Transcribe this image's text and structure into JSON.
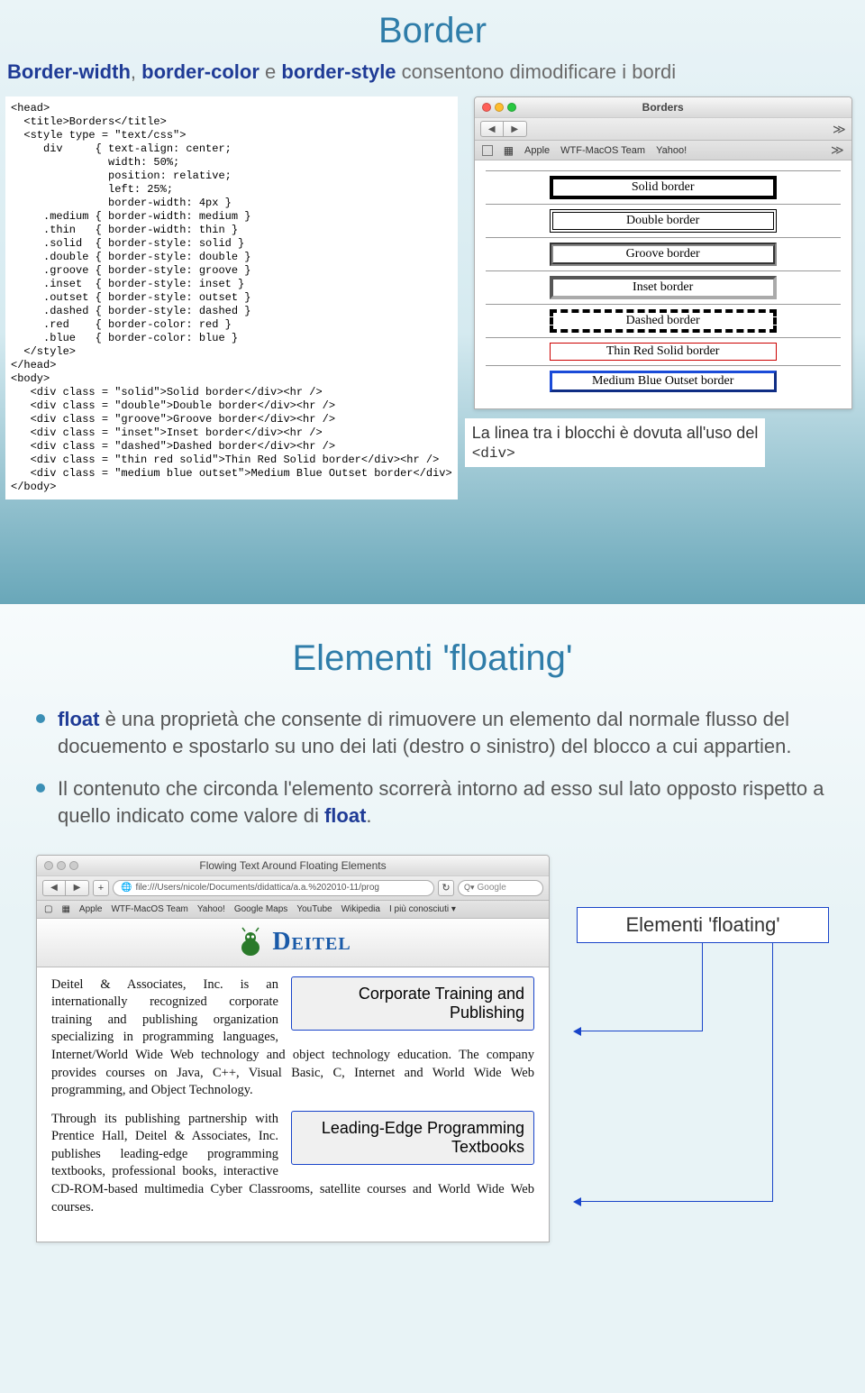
{
  "slide1": {
    "title": "Border",
    "subtitle": {
      "a": "Border-width",
      "sep1": ", ",
      "b": "border-color",
      "sep2": " e ",
      "c": "border-style",
      "rest": " consentono dimodificare i bordi"
    },
    "code": "<head>\n  <title>Borders</title>\n  <style type = \"text/css\">\n     div     { text-align: center;\n               width: 50%;\n               position: relative;\n               left: 25%;\n               border-width: 4px }\n     .medium { border-width: medium }\n     .thin   { border-width: thin }\n     .solid  { border-style: solid }\n     .double { border-style: double }\n     .groove { border-style: groove }\n     .inset  { border-style: inset }\n     .outset { border-style: outset }\n     .dashed { border-style: dashed }\n     .red    { border-color: red }\n     .blue   { border-color: blue }\n  </style>\n</head>\n<body>\n   <div class = \"solid\">Solid border</div><hr />\n   <div class = \"double\">Double border</div><hr />\n   <div class = \"groove\">Groove border</div><hr />\n   <div class = \"inset\">Inset border</div><hr />\n   <div class = \"dashed\">Dashed border</div><hr />\n   <div class = \"thin red solid\">Thin Red Solid border</div><hr />\n   <div class = \"medium blue outset\">Medium Blue Outset border</div>\n</body>",
    "window": {
      "title": "Borders",
      "bookmarks": [
        "Apple",
        "WTF-MacOS Team",
        "Yahoo!"
      ],
      "boxes": {
        "solid": "Solid border",
        "double": "Double border",
        "groove": "Groove border",
        "inset": "Inset border",
        "dashed": "Dashed border",
        "thin_red": "Thin Red Solid border",
        "med_blue": "Medium Blue Outset border"
      }
    },
    "note_line1": "La linea tra i blocchi è dovuta all'uso del",
    "note_line2": "<div>"
  },
  "slide2": {
    "title": "Elementi 'floating'",
    "bullet1_a": "float",
    "bullet1_b": " è una proprietà che consente di rimuovere un elemento dal normale flusso del docuemento e spostarlo su uno dei lati (destro o sinistro) del blocco a cui appartien.",
    "bullet2_a": "Il contenuto che circonda l'elemento scorrerà intorno ad esso sul lato opposto rispetto a quello indicato come valore di ",
    "bullet2_b": "float",
    "bullet2_c": ".",
    "window": {
      "title": "Flowing Text Around Floating Elements",
      "url": "file:///Users/nicole/Documents/didattica/a.a.%202010-11/prog",
      "reload": "↻",
      "search": "Google",
      "bookmarks": [
        "Apple",
        "WTF-MacOS Team",
        "Yahoo!",
        "Google Maps",
        "YouTube",
        "Wikipedia",
        "I più conosciuti ▾"
      ],
      "brand": "Deitel",
      "float1": "Corporate Training and Publishing",
      "float2": "Leading-Edge Programming Textbooks",
      "para1": "Deitel & Associates, Inc. is an internationally recognized corporate training and publishing organization specializing in programming languages, Internet/World Wide Web technology and object technology education. The company provides courses on Java, C++, Visual Basic, C, Internet and World Wide Web programming, and Object Technology.",
      "para2": "Through its publishing partnership with Prentice Hall, Deitel & Associates, Inc. publishes leading-edge programming textbooks, professional books, interactive CD-ROM-based multimedia Cyber Classrooms, satellite courses and World Wide Web courses."
    },
    "callout": "Elementi 'floating'"
  }
}
